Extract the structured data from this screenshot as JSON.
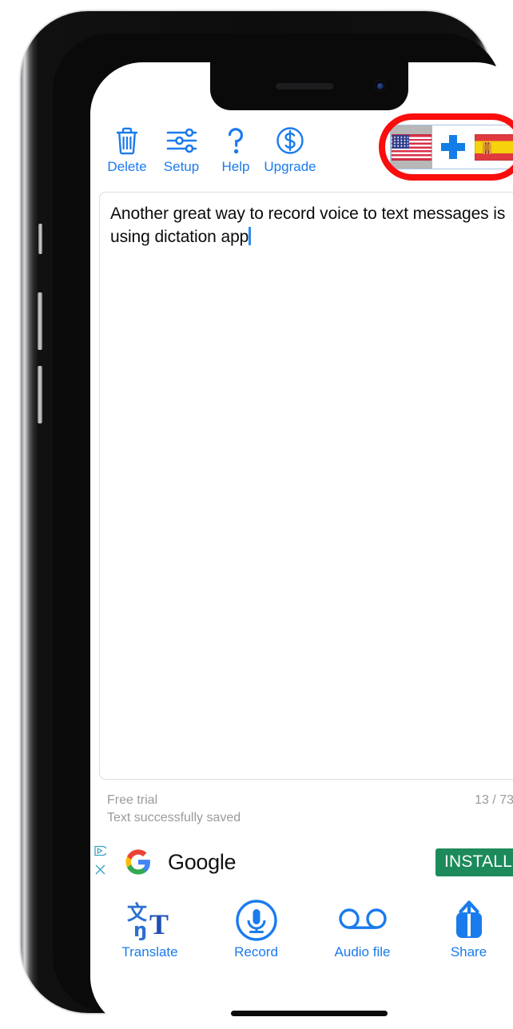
{
  "app": {
    "top_toolbar": [
      {
        "label": "Delete",
        "icon": "trash-icon"
      },
      {
        "label": "Setup",
        "icon": "sliders-icon"
      },
      {
        "label": "Help",
        "icon": "question-mark-icon"
      },
      {
        "label": "Upgrade",
        "icon": "dollar-circle-icon"
      }
    ],
    "language_selector": {
      "source_language": "United States",
      "source_flag_icon": "flag-us-icon",
      "add_icon": "plus-icon",
      "target_language": "Spain",
      "target_flag_icon": "flag-es-icon",
      "selected": "United States",
      "highlight_color": "#fa0d0d"
    },
    "editor": {
      "text": "Another great way to record voice to text messages is using dictation app",
      "caret_color": "#2f8ef0"
    },
    "status": {
      "plan": "Free trial",
      "message": "Text successfully saved",
      "counter": "13 / 73"
    },
    "ad": {
      "advertiser": "Google",
      "logo_icon": "google-g-icon",
      "adchoices_icon": "adchoices-triangle-icon",
      "close_icon": "close-x-icon",
      "cta_label": "INSTALL",
      "cta_color": "#1c8a5b"
    },
    "bottom_toolbar": [
      {
        "label": "Translate",
        "icon": "translate-icon"
      },
      {
        "label": "Record",
        "icon": "microphone-circle-icon"
      },
      {
        "label": "Audio file",
        "icon": "voicemail-icon"
      },
      {
        "label": "Share",
        "icon": "share-upload-icon"
      }
    ],
    "accent_color": "#1a7bed"
  },
  "device": {
    "home_indicator": "home-indicator",
    "notch": "notch"
  }
}
